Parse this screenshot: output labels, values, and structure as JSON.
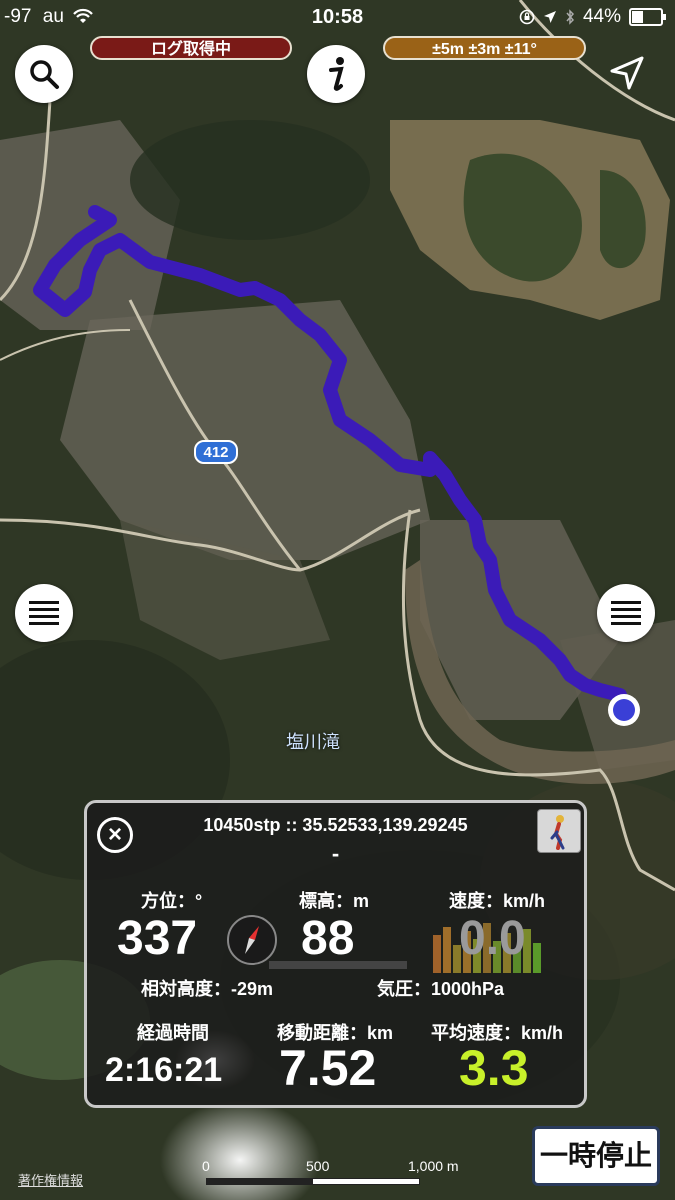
{
  "status_bar": {
    "signal": "-97",
    "carrier": "au",
    "time": "10:58",
    "battery": "44%",
    "battery_level": 0.44
  },
  "pills": {
    "logging": "ログ取得中",
    "accuracy": "±5m ±3m ±11°"
  },
  "map": {
    "place_label": "塩川滝",
    "route_number": "412",
    "route_color": "#3b1bb8",
    "location_color": "#3a3fd6"
  },
  "panel": {
    "steps_coords": "10450stp :: 35.52533,139.29245",
    "subtitle": "-",
    "bearing_label": "方位：°",
    "bearing_value": "337",
    "elevation_label": "標高：m",
    "elevation_value": "88",
    "speed_label": "速度：km/h",
    "speed_value": "0.0",
    "relative_height": "相対高度：-29m",
    "pressure": "気圧：1000hPa",
    "elapsed_label": "経過時間",
    "elapsed_value": "2:16:21",
    "distance_label": "移動距離：km",
    "distance_value": "7.52",
    "avg_speed_label": "平均速度：km/h",
    "avg_speed_value": "3.3",
    "avg_speed_color": "#c8f02a"
  },
  "pause_button": "一時停止",
  "copyright": "著作権情報",
  "scale": {
    "ticks": [
      "0",
      "500",
      "1,000 m"
    ]
  }
}
